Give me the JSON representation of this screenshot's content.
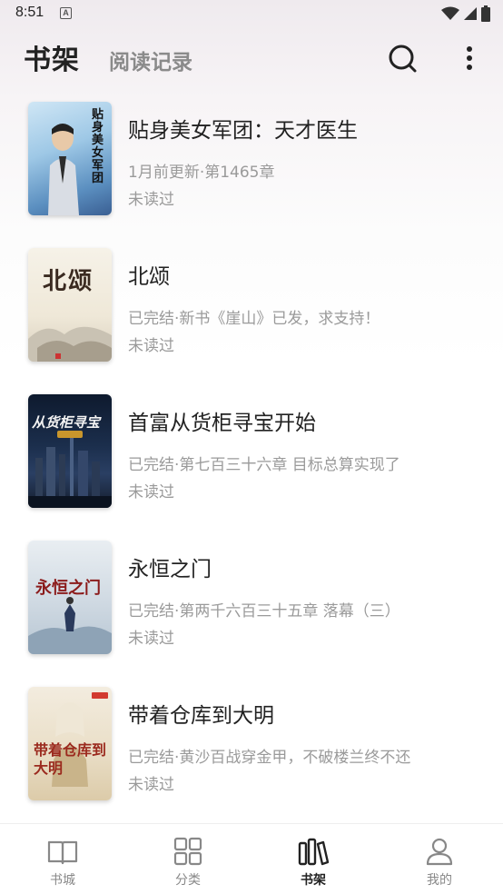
{
  "status_bar": {
    "time": "8:51",
    "notification_letter": "A"
  },
  "header": {
    "tab_active": "书架",
    "tab_inactive": "阅读记录"
  },
  "books": [
    {
      "title": "贴身美女军团：天才医生",
      "status": "1月前更新·第1465章",
      "read": "未读过",
      "cover_text": "贴身美女军团"
    },
    {
      "title": "北颂",
      "status": "已完结·新书《崖山》已发，求支持！",
      "read": "未读过",
      "cover_text": "北颂"
    },
    {
      "title": "首富从货柜寻宝开始",
      "status": "已完结·第七百三十六章 目标总算实现了",
      "read": "未读过",
      "cover_text": "从货柜寻宝"
    },
    {
      "title": "永恒之门",
      "status": "已完结·第两千六百三十五章 落幕（三）",
      "read": "未读过",
      "cover_text": "永恒之门"
    },
    {
      "title": "带着仓库到大明",
      "status": "已完结·黄沙百战穿金甲，不破楼兰终不还",
      "read": "未读过",
      "cover_text": "带着仓库到大明"
    }
  ],
  "bottom_nav": [
    {
      "label": "书城",
      "icon": "book-open-icon",
      "active": false
    },
    {
      "label": "分类",
      "icon": "grid-icon",
      "active": false
    },
    {
      "label": "书架",
      "icon": "bookshelf-icon",
      "active": true
    },
    {
      "label": "我的",
      "icon": "user-icon",
      "active": false
    }
  ],
  "colors": {
    "accent_text": "#222222",
    "muted_text": "#9a9a9a",
    "background_top": "#efeaee"
  }
}
